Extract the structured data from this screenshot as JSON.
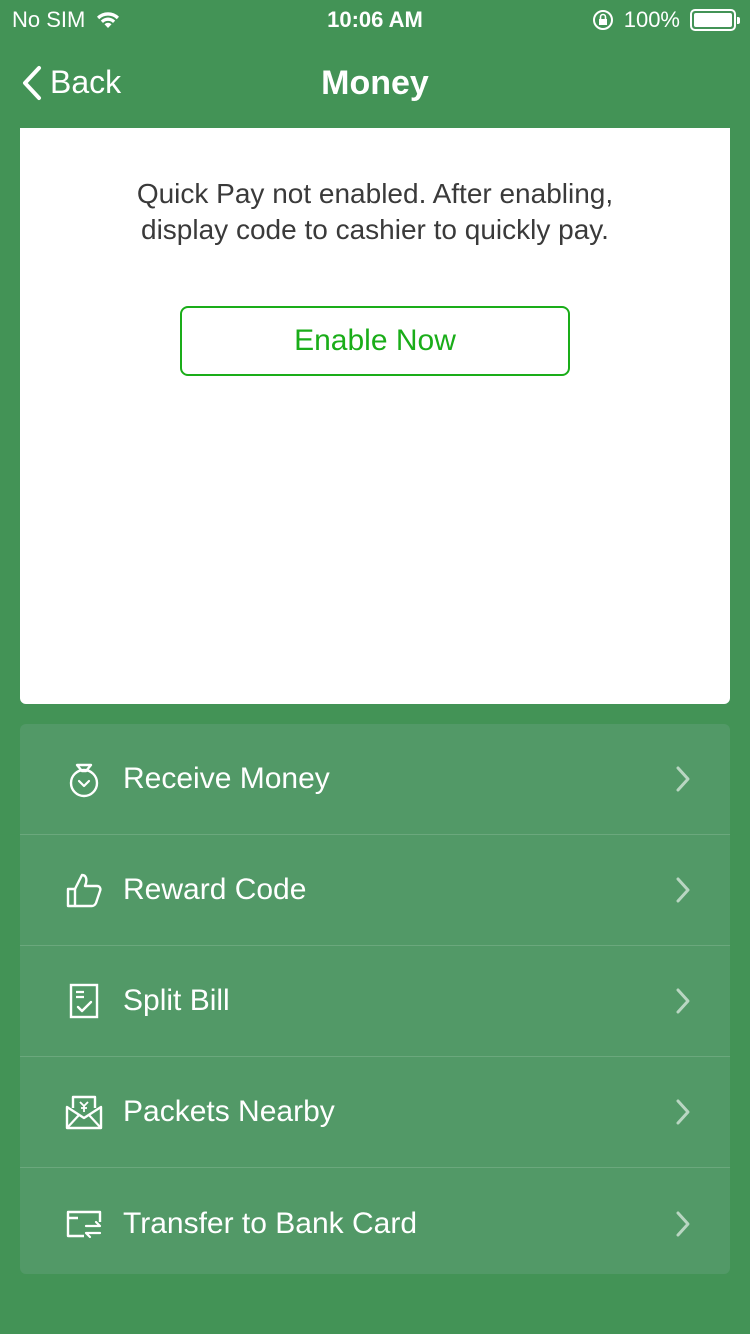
{
  "status_bar": {
    "carrier": "No SIM",
    "time": "10:06 AM",
    "battery": "100%"
  },
  "nav": {
    "back_label": "Back",
    "title": "Money"
  },
  "quick_pay": {
    "message_line1": "Quick Pay not enabled. After enabling,",
    "message_line2": "display code to cashier to quickly pay.",
    "button_label": "Enable Now"
  },
  "menu": {
    "items": [
      {
        "label": "Receive Money",
        "icon": "money-bag-icon"
      },
      {
        "label": "Reward Code",
        "icon": "thumbs-up-icon"
      },
      {
        "label": "Split Bill",
        "icon": "bill-icon"
      },
      {
        "label": "Packets Nearby",
        "icon": "red-packet-icon"
      },
      {
        "label": "Transfer to Bank Card",
        "icon": "bank-transfer-icon"
      }
    ]
  },
  "colors": {
    "background": "#439356",
    "menu_background": "#529967",
    "accent": "#1aad19"
  }
}
